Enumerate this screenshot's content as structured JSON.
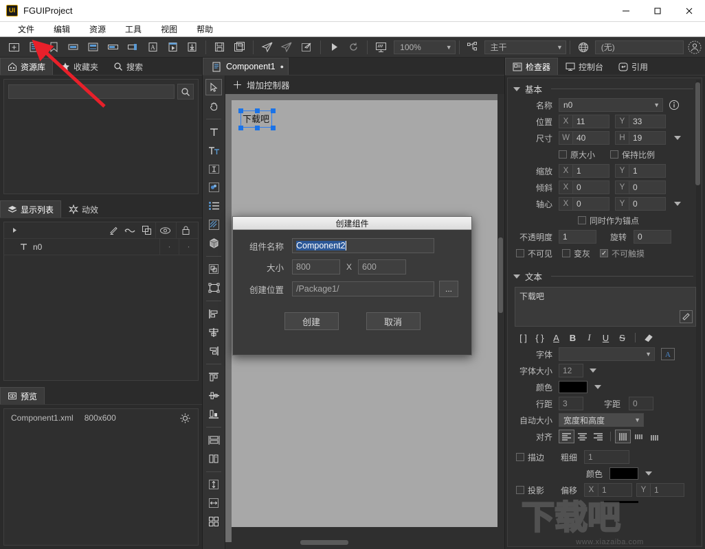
{
  "window": {
    "logo_text": "UI",
    "title": "FGUIProject",
    "minimize": "–",
    "maximize": "□",
    "close": "✕"
  },
  "menubar": {
    "items": [
      {
        "label": "文件",
        "name": "menu-file"
      },
      {
        "label": "编辑",
        "name": "menu-edit"
      },
      {
        "label": "资源",
        "name": "menu-resource"
      },
      {
        "label": "工具",
        "name": "menu-tools"
      },
      {
        "label": "视图",
        "name": "menu-view"
      },
      {
        "label": "帮助",
        "name": "menu-help"
      }
    ]
  },
  "toolbar": {
    "zoom_value": "100%",
    "branch_value": "主干",
    "publish_value": "(无)",
    "icons": [
      "new-folder-icon",
      "new-component-icon",
      "bookmark-icon",
      "new-button-icon",
      "new-label-icon",
      "new-progressbar-icon",
      "new-slider-icon",
      "new-font-icon",
      "new-movieclip-icon",
      "import-icon",
      "save-icon",
      "save-all-icon",
      "publish-icon",
      "publish-all-icon",
      "publish-settings-icon",
      "run-icon",
      "refresh-icon",
      "preview-device-icon",
      "branch-icon",
      "globe-icon",
      "account-icon"
    ]
  },
  "left_panel": {
    "tabs": [
      {
        "label": "资源库",
        "icon": "home-icon",
        "active": true
      },
      {
        "label": "收藏夹",
        "icon": "star-icon",
        "active": false
      },
      {
        "label": "搜索",
        "icon": "search-icon",
        "active": false
      }
    ],
    "search_placeholder": "",
    "search_value": "",
    "display_tabs": [
      {
        "label": "显示列表",
        "icon": "layers-icon",
        "active": true
      },
      {
        "label": "动效",
        "icon": "transition-icon",
        "active": false
      }
    ],
    "list_tool_icons": [
      "expand-arrow-icon",
      "pencil-icon",
      "link-icon",
      "copy-icon",
      "eye-icon",
      "lock-icon"
    ],
    "tree_items": [
      {
        "icon": "text-icon",
        "label": "n0",
        "visible_dot": "·",
        "lock_dot": "·"
      }
    ],
    "preview_tab": {
      "label": "预览",
      "icon": "preview-eye-icon"
    },
    "preview_file": "Component1.xml",
    "preview_size": "800x600",
    "preview_settings_icon": "gear-icon"
  },
  "center_panel": {
    "doc_tab": {
      "label": "Component1",
      "modified_dot": "●",
      "icon": "document-icon"
    },
    "add_controller": "增加控制器",
    "vtools": [
      "pointer-icon",
      "hand-icon",
      "text-tool-icon",
      "richtext-tool-icon",
      "input-text-icon",
      "loader-icon",
      "list-icon",
      "graph-icon",
      "group3d-icon",
      "component-icon",
      "transform-icon",
      "align-left-icon",
      "align-center-icon",
      "align-right-icon",
      "align-top-icon",
      "align-middle-icon",
      "align-bottom-icon",
      "distribute-vertical-icon",
      "distribute-horizontal-icon",
      "same-height-icon",
      "same-width-icon",
      "grid-icon"
    ],
    "stage_object": {
      "text": "下载吧"
    }
  },
  "inspector": {
    "tabs": [
      {
        "label": "检查器",
        "icon": "inspector-icon",
        "active": true
      },
      {
        "label": "控制台",
        "icon": "console-icon",
        "active": false
      },
      {
        "label": "引用",
        "icon": "reference-icon",
        "active": false
      }
    ],
    "basic": {
      "section_title": "基本",
      "name_label": "名称",
      "name_value": "n0",
      "info_icon": "info-icon",
      "position_label": "位置",
      "pos_x_axis": "X",
      "pos_x": "11",
      "pos_y_axis": "Y",
      "pos_y": "33",
      "size_label": "尺寸",
      "size_w_axis": "W",
      "size_w": "40",
      "size_h_axis": "H",
      "size_h": "19",
      "orig_size_label": "原大小",
      "orig_size_checked": false,
      "keep_ratio_label": "保持比例",
      "keep_ratio_checked": false,
      "scale_label": "缩放",
      "scale_x_axis": "X",
      "scale_x": "1",
      "scale_y_axis": "Y",
      "scale_y": "1",
      "skew_label": "倾斜",
      "skew_x_axis": "X",
      "skew_x": "0",
      "skew_y_axis": "Y",
      "skew_y": "0",
      "pivot_label": "轴心",
      "pivot_x_axis": "X",
      "pivot_x": "0",
      "pivot_y_axis": "Y",
      "pivot_y": "0",
      "anchor_label": "同时作为锚点",
      "anchor_checked": false,
      "opacity_label": "不透明度",
      "opacity_value": "1",
      "rotation_label": "旋转",
      "rotation_value": "0",
      "invisible_label": "不可见",
      "invisible_checked": false,
      "grayed_label": "变灰",
      "grayed_checked": false,
      "untouchable_label": "不可触摸",
      "untouchable_checked": true
    },
    "text": {
      "section_title": "文本",
      "content": "下载吧",
      "expand_icon": "expand-editor-icon",
      "format_buttons": [
        "[ ]",
        "{ }",
        "A",
        "B",
        "I",
        "U",
        "S",
        "eraser-icon"
      ],
      "font_label": "字体",
      "font_value": "",
      "font_picker_icon": "font-picker-icon",
      "font_size_label": "字体大小",
      "font_size_value": "12",
      "color_label": "颜色",
      "color_value": "#000000",
      "line_spacing_label": "行距",
      "line_spacing_value": "3",
      "letter_spacing_label": "字距",
      "letter_spacing_value": "0",
      "autosize_label": "自动大小",
      "autosize_value": "宽度和高度",
      "align_label": "对齐",
      "align_h_selected": 0,
      "align_v_selected": 0,
      "stroke_label": "描边",
      "stroke_checked": false,
      "stroke_size_label": "粗细",
      "stroke_size_value": "1",
      "stroke_color_label": "颜色",
      "stroke_color_value": "#000000",
      "shadow_label": "投影",
      "shadow_checked": false,
      "shadow_offset_label": "偏移",
      "shadow_x_axis": "X",
      "shadow_x": "1",
      "shadow_y_axis": "Y",
      "shadow_y": "1"
    }
  },
  "dialog": {
    "title": "创建组件",
    "name_label": "组件名称",
    "name_value": "Component2",
    "size_label": "大小",
    "size_w": "800",
    "size_sep": "X",
    "size_h": "600",
    "location_label": "创建位置",
    "location_value": "/Package1/",
    "browse_label": "...",
    "ok_label": "创建",
    "cancel_label": "取消"
  },
  "watermark": {
    "text": "下载吧",
    "url": "www.xiazaiba.com"
  },
  "colors": {
    "accent_blue": "#2d7ff0",
    "annotation_red": "#e8202a",
    "panel_bg": "#2b2b2b",
    "stage_bg": "#a8a8a8"
  }
}
